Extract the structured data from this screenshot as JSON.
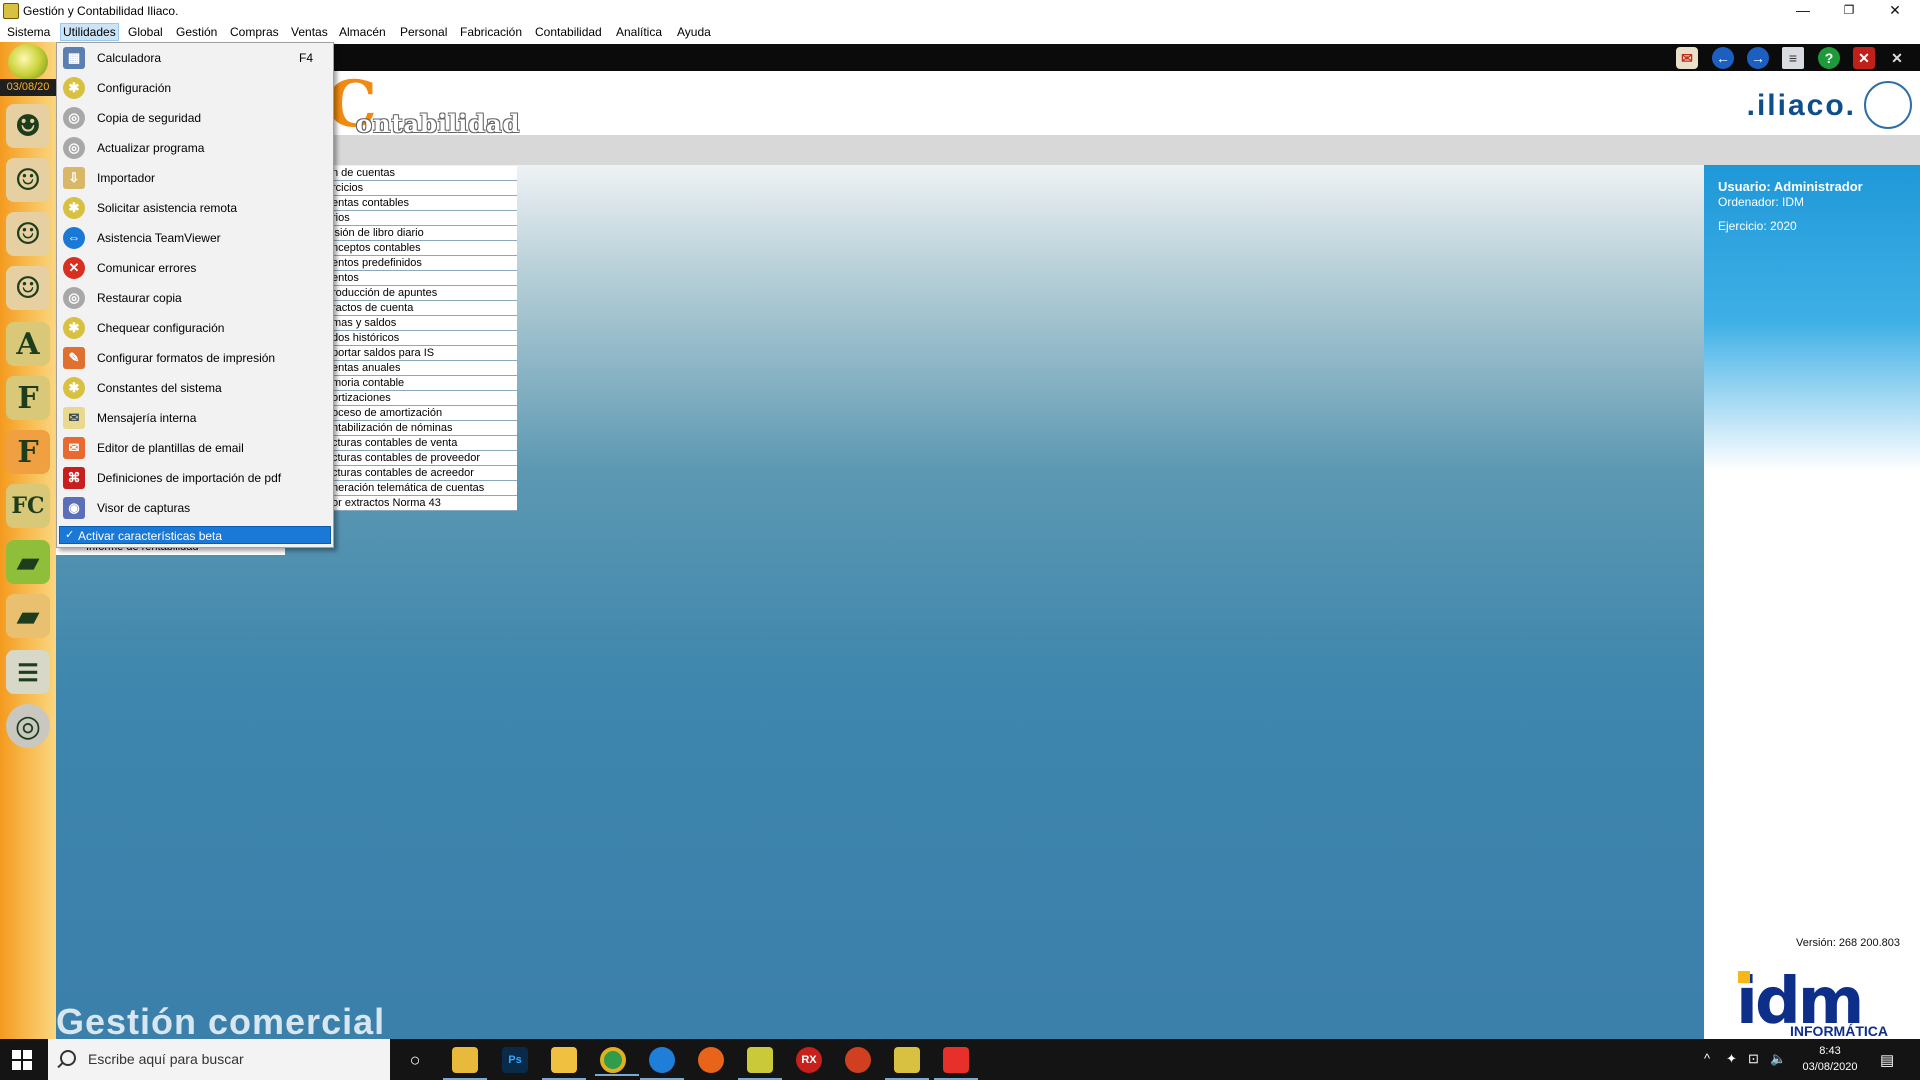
{
  "window": {
    "title": "Gestión y Contabilidad Iliaco.",
    "minimize": "—",
    "restore": "❐",
    "close": "✕"
  },
  "menubar": [
    "Sistema",
    "Utilidades",
    "Global",
    "Gestión",
    "Compras",
    "Ventas",
    "Almacén",
    "Personal",
    "Fabricación",
    "Contabilidad",
    "Analítica",
    "Ayuda"
  ],
  "sidebar": {
    "date": "03/08/20",
    "letters": [
      "A",
      "F",
      "F",
      "FC"
    ]
  },
  "header": {
    "logo_letter": "C",
    "logo_word": "ontabilidad",
    "brand": ".iliaco."
  },
  "utilidades_menu": {
    "items": [
      {
        "label": "Calculadora",
        "shortcut": "F4",
        "icon": "calculator-icon"
      },
      {
        "label": "Configuración",
        "icon": "gear-icon"
      },
      {
        "label": "Copia de seguridad",
        "icon": "disc-icon"
      },
      {
        "label": "Actualizar programa",
        "icon": "disc-icon"
      },
      {
        "label": "Importador",
        "icon": "import-icon"
      },
      {
        "label": "Solicitar asistencia remota",
        "icon": "gear-icon"
      },
      {
        "label": "Asistencia TeamViewer",
        "icon": "teamviewer-icon"
      },
      {
        "label": "Comunicar errores",
        "icon": "error-icon"
      },
      {
        "label": "Restaurar copia",
        "icon": "disc-icon"
      },
      {
        "label": "Chequear configuración",
        "icon": "gear-icon"
      },
      {
        "label": "Configurar formatos de impresión",
        "icon": "print-format-icon"
      },
      {
        "label": "Constantes del sistema",
        "icon": "gear-icon"
      },
      {
        "label": "Mensajería interna",
        "icon": "mail-icon"
      },
      {
        "label": "Editor de plantillas de email",
        "icon": "email-template-icon"
      },
      {
        "label": "Definiciones de importación de pdf",
        "icon": "pdf-icon"
      },
      {
        "label": "Visor de capturas",
        "icon": "capture-viewer-icon"
      }
    ],
    "beta": {
      "label": "Activar características beta",
      "checked": "✓"
    }
  },
  "module_list": [
    "n de cuentas",
    "rcicios",
    "entas contables",
    "rios",
    "isión de libro diario",
    "nceptos contables",
    "entos predefinidos",
    "entos",
    "roducción de apuntes",
    "ractos de cuenta",
    "mas y saldos",
    "dos históricos",
    "portar saldos para IS",
    "entas anuales",
    "moria contable",
    "ortizaciones",
    "oceso de amortización",
    "ntabilización de nóminas",
    "cturas contables de venta",
    "cturas contables de proveedor",
    "cturas contables de acreedor",
    "neración telemática de cuentas",
    "or extractos Norma 43"
  ],
  "hidden_item": "Informe de rentabilidad",
  "main": {
    "watermark": "Gestión comercial"
  },
  "info_panel": {
    "usuario": "Usuario: Administrador",
    "ordenador": "Ordenador: IDM",
    "ejercicio": "Ejercicio: 2020",
    "version": "Versión: 268 200.803",
    "company": "idm",
    "company_sub": "INFORMÁTICA"
  },
  "taskbar": {
    "search_placeholder": "Escribe aquí para buscar",
    "apps": [
      {
        "name": "task-view",
        "label": "○",
        "color": "#141414"
      },
      {
        "name": "file-explorer",
        "label": "",
        "color": "#e8b93a"
      },
      {
        "name": "photoshop",
        "label": "Ps",
        "color": "#0a2a4a"
      },
      {
        "name": "folder-app",
        "label": "",
        "color": "#f0c040"
      },
      {
        "name": "chrome",
        "label": "",
        "color": "#2f9d4a"
      },
      {
        "name": "edge",
        "label": "",
        "color": "#1f7fd8"
      },
      {
        "name": "firefox",
        "label": "",
        "color": "#e8641a"
      },
      {
        "name": "iliaco-app",
        "label": "",
        "color": "#c9c93a"
      },
      {
        "name": "rx-app",
        "label": "RX",
        "color": "#c8201a"
      },
      {
        "name": "media-app",
        "label": "",
        "color": "#d04020"
      },
      {
        "name": "iliaco-active",
        "label": "",
        "color": "#d8c040"
      },
      {
        "name": "anydesk",
        "label": "",
        "color": "#e8302a"
      }
    ],
    "tray": {
      "chevron": "^",
      "dropbox": "✦",
      "network": "⊡",
      "volume": "🔈",
      "notifications": "▤"
    },
    "time": "8:43",
    "date": "03/08/2020"
  },
  "colors": {
    "menu_highlight": "#1a78d6",
    "sidebar_orange": "#f49a1f",
    "panel_blue": "#1f98d8"
  }
}
